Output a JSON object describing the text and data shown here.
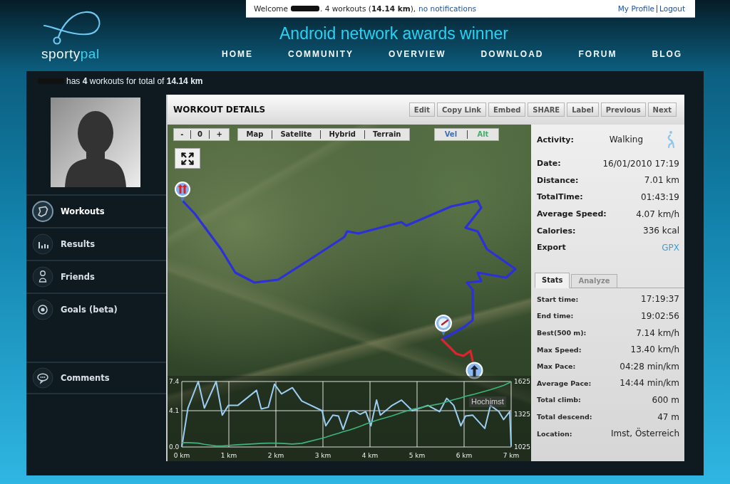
{
  "header": {
    "logo": [
      "sporty",
      "pal"
    ],
    "welcome": {
      "greeting": "Welcome",
      "summary": ". 4 workouts (**14.14 km**),",
      "notifications": "no notifications"
    },
    "account_links": [
      "My Profile",
      "Logout"
    ],
    "banner": "Android network awards winner",
    "nav": [
      "HOME",
      "COMMUNITY",
      "OVERVIEW",
      "DOWNLOAD",
      "FORUM",
      "BLOG"
    ]
  },
  "user_summary": "has **4** workouts for total of **14.14 km**",
  "sidebar": {
    "menu": [
      {
        "label": "Workouts",
        "selected": true
      },
      {
        "label": "Results",
        "selected": false
      },
      {
        "label": "Friends",
        "selected": false
      },
      {
        "label": "Goals (beta)",
        "selected": false
      }
    ],
    "extra_menu": [
      {
        "label": "Comments",
        "selected": false
      }
    ]
  },
  "workout_details": {
    "title": "WORKOUT DETAILS",
    "actions": [
      "Edit",
      "Copy Link",
      "Embed",
      "SHARE",
      "Label",
      "Previous",
      "Next"
    ],
    "map": {
      "zoom_controls": [
        "-",
        "0",
        "+"
      ],
      "map_types": [
        "Map",
        "Satelite",
        "Hybrid",
        "Terrain"
      ],
      "layers": [
        {
          "color": "#3f6fb3"
        },
        {
          "color": "#41ad6b"
        }
      ],
      "place_label": "Hochimst",
      "chart_data": {
        "type": "line",
        "grid": true,
        "x": [
          0,
          0.13,
          0.35,
          0.48,
          0.73,
          0.86,
          0.99,
          1.19,
          1.59,
          1.69,
          1.84,
          1.97,
          2.12,
          2.35,
          2.55,
          2.98,
          3.06,
          3.21,
          3.33,
          3.43,
          3.56,
          3.66,
          3.79,
          3.91,
          4.02,
          4.14,
          4.22,
          4.47,
          4.67,
          4.9,
          5.23,
          5.48,
          5.63,
          5.78,
          5.93,
          6.03,
          6.18,
          6.44,
          6.56,
          6.74,
          6.84,
          6.97,
          7.0
        ],
        "series": [
          {
            "name": "Vel",
            "color": "#9ccdf2",
            "values": [
              0,
              4.4,
              7.4,
              4.4,
              7.4,
              3.6,
              4.7,
              4.7,
              6.4,
              4.3,
              4.5,
              7.1,
              6.0,
              6.7,
              5.2,
              4.1,
              2.4,
              3.6,
              3.5,
              2.0,
              4.0,
              4.1,
              3.7,
              4.0,
              2.4,
              5.3,
              3.6,
              4.7,
              5.3,
              4.1,
              4.7,
              4.0,
              5.5,
              4.7,
              2.4,
              3.5,
              3.6,
              2.1,
              4.7,
              4.0,
              3.1,
              4.0,
              0.1
            ]
          },
          {
            "name": "Alt",
            "color": "#3db57c",
            "axis": "y2",
            "values": [
              1065,
              1065,
              1060,
              1050,
              1035,
              1035,
              1040,
              1045,
              1055,
              1058,
              1060,
              1060,
              1058,
              1052,
              1058,
              1105,
              1115,
              1135,
              1150,
              1165,
              1180,
              1195,
              1215,
              1235,
              1252,
              1270,
              1280,
              1310,
              1340,
              1370,
              1400,
              1420,
              1440,
              1458,
              1475,
              1490,
              1505,
              1535,
              1550,
              1575,
              1590,
              1615,
              1620
            ]
          }
        ],
        "xlim": [
          0,
          7
        ],
        "ylim": [
          0,
          7.4
        ],
        "xticks": [
          {
            "value": 0,
            "label": "0 km"
          },
          {
            "value": 1,
            "label": "1 km"
          },
          {
            "value": 2,
            "label": "2 km"
          },
          {
            "value": 3,
            "label": "3 km"
          },
          {
            "value": 4,
            "label": "4 km"
          },
          {
            "value": 5,
            "label": "5 km"
          },
          {
            "value": 6,
            "label": "6 km"
          },
          {
            "value": 7,
            "label": "7 km"
          }
        ],
        "yticks": [
          {
            "value": 0,
            "label": "0.0"
          },
          {
            "value": 4.1,
            "label": "4.1"
          },
          {
            "value": 7.4,
            "label": "7.4"
          }
        ],
        "y2lim": [
          1025,
          1625
        ],
        "y2ticks": [
          1025,
          1325,
          1625
        ]
      }
    },
    "summary": [
      {
        "kind": "activity",
        "label": "Activity:",
        "value": "Walking"
      },
      {
        "kind": "text",
        "label": "Date:",
        "value": "16/01/2010 17:19"
      },
      {
        "kind": "text",
        "label": "Distance:",
        "value": "7.01 km"
      },
      {
        "kind": "text",
        "label": "TotalTime:",
        "value": "01:43:19"
      },
      {
        "kind": "text",
        "label": "Average Speed:",
        "value": "4.07 km/h"
      },
      {
        "kind": "text",
        "label": "Calories:",
        "value": "336 kcal"
      },
      {
        "kind": "link",
        "label": "Export",
        "value": "GPX"
      }
    ],
    "tabs": [
      {
        "label": "Stats",
        "selected": true
      },
      {
        "label": "Analyze",
        "selected": false
      }
    ],
    "stats": [
      {
        "label": "Start time:",
        "value": "17:19:37"
      },
      {
        "label": "End time:",
        "value": "19:02:56"
      },
      {
        "label": "Best(500 m):",
        "value": "7.14 km/h"
      },
      {
        "label": "Max Speed:",
        "value": "13.40 km/h"
      },
      {
        "label": "Max Pace:",
        "value": "04:28 min/km"
      },
      {
        "label": "Average Pace:",
        "value": "14:44 min/km"
      },
      {
        "label": "Total climb:",
        "value": "600 m"
      },
      {
        "label": "Total descend:",
        "value": "47 m"
      },
      {
        "label": "Location:",
        "value": "Imst, Österreich"
      }
    ]
  }
}
